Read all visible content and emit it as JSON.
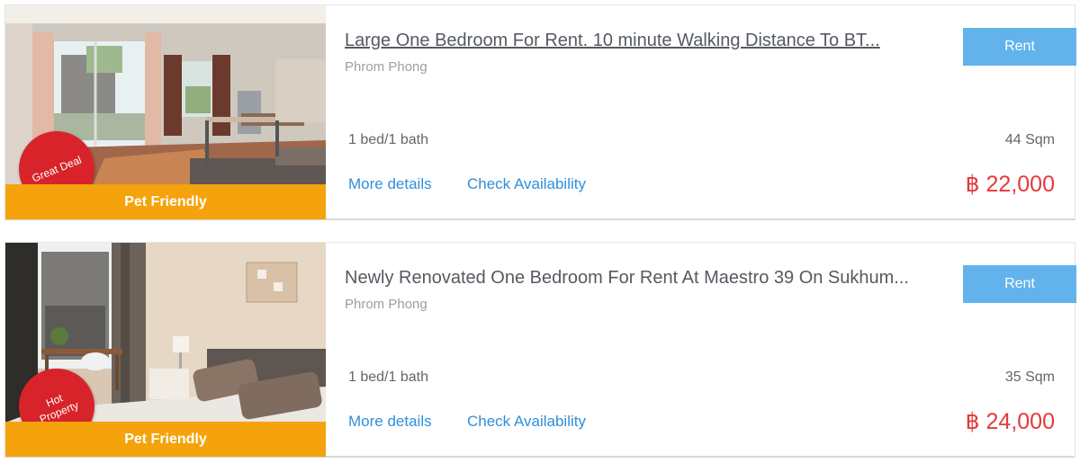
{
  "listings": [
    {
      "title": "Large One Bedroom For Rent. 10 minute Walking Distance To BT...",
      "location": "Phrom Phong",
      "beds_baths": "1 bed/1 bath",
      "size": "44 Sqm",
      "price": "฿ 22,000",
      "rent_label": "Rent",
      "more_details": "More details",
      "check_availability": "Check Availability",
      "badge": "Great Deal",
      "ribbon": "Pet Friendly"
    },
    {
      "title": "Newly Renovated One Bedroom For Rent At Maestro 39 On Sukhum...",
      "location": "Phrom Phong",
      "beds_baths": "1 bed/1 bath",
      "size": "35 Sqm",
      "price": "฿ 24,000",
      "rent_label": "Rent",
      "more_details": "More details",
      "check_availability": "Check Availability",
      "badge": "Hot Property",
      "ribbon": "Pet Friendly"
    }
  ],
  "colors": {
    "ribbon": "#f5a30c",
    "badge": "#d8232a",
    "rent_button": "#62b3ec",
    "link": "#2e8fdc",
    "price": "#e4393c"
  }
}
